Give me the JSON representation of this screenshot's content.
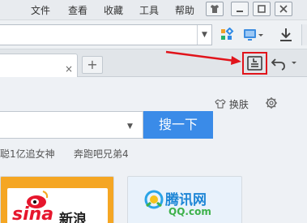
{
  "menu": [
    "文件",
    "查看",
    "收藏",
    "工具",
    "帮助"
  ],
  "window_buttons": [
    "shirt-icon",
    "minimize-icon",
    "maximize-icon",
    "close-icon"
  ],
  "address_bar": {
    "value": "",
    "icons": [
      "apps-icon",
      "screenshot-icon",
      "download-icon"
    ]
  },
  "tab": {
    "close_glyph": "×",
    "new_glyph": "+"
  },
  "toolbar_right": {
    "highlighted_icon": "sidebar-toggle-icon",
    "undo_icon": "undo-icon"
  },
  "content": {
    "skin_label": "换肤",
    "search_button": "搜一下",
    "hot_searches": [
      "聪1亿追女神",
      "奔跑吧兄弟4"
    ],
    "cards": [
      {
        "name": "sina",
        "logo_text": "sina",
        "logo_cn": "新浪"
      },
      {
        "name": "tencent",
        "logo_text": "腾讯网",
        "logo_sub": "QQ.com"
      }
    ]
  },
  "colors": {
    "accent": "#3a8be8",
    "annotation": "#e1141b",
    "sina_card": "#f5a623"
  }
}
